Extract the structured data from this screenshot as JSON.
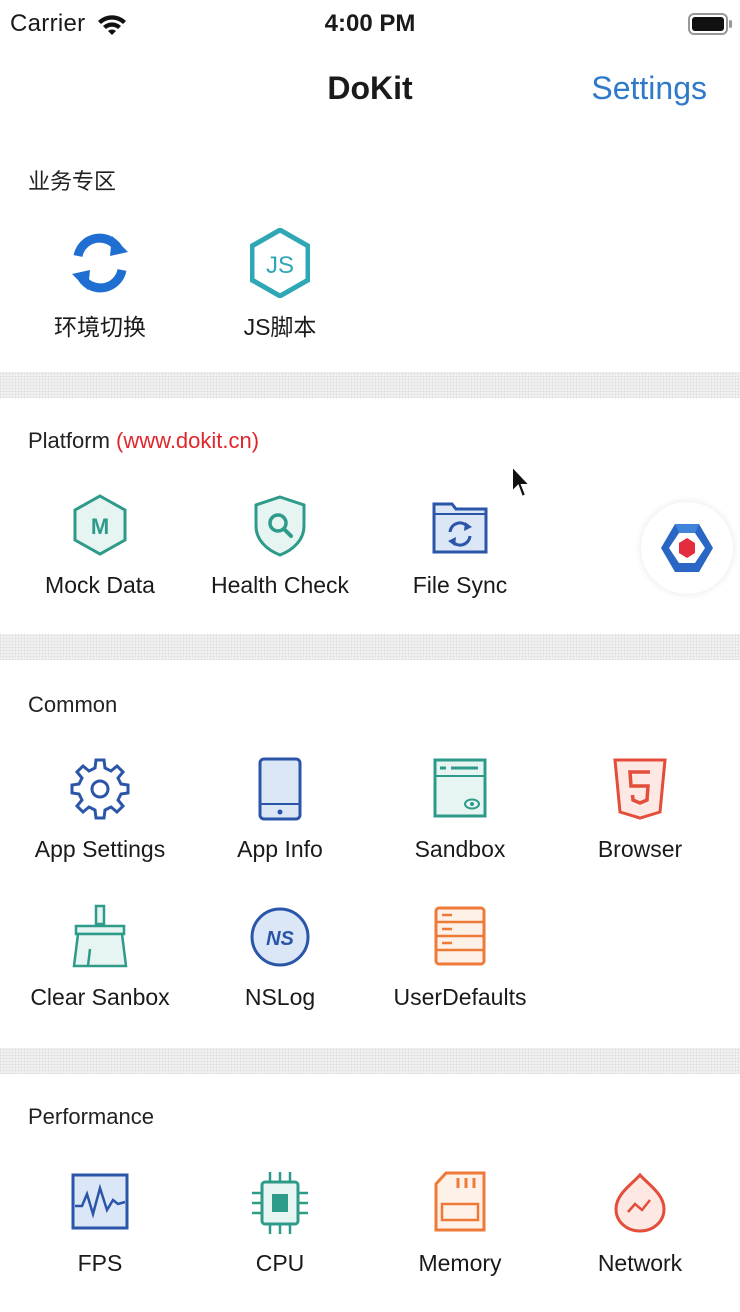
{
  "status_bar": {
    "carrier": "Carrier",
    "time": "4:00 PM"
  },
  "nav": {
    "title": "DoKit",
    "settings_label": "Settings"
  },
  "sections": {
    "business": {
      "title": "业务专区",
      "items": [
        {
          "label": "环境切换",
          "icon": "refresh-icon"
        },
        {
          "label": "JS脚本",
          "icon": "js-icon"
        }
      ]
    },
    "platform": {
      "title": "Platform",
      "url": "(www.dokit.cn)",
      "items": [
        {
          "label": "Mock Data",
          "icon": "mock-data-icon"
        },
        {
          "label": "Health Check",
          "icon": "health-check-icon"
        },
        {
          "label": "File Sync",
          "icon": "file-sync-icon"
        }
      ]
    },
    "common": {
      "title": "Common",
      "items": [
        {
          "label": "App Settings",
          "icon": "gear-icon"
        },
        {
          "label": "App Info",
          "icon": "phone-icon"
        },
        {
          "label": "Sandbox",
          "icon": "sandbox-icon"
        },
        {
          "label": "Browser",
          "icon": "html5-icon"
        },
        {
          "label": "Clear Sanbox",
          "icon": "broom-icon"
        },
        {
          "label": "NSLog",
          "icon": "nslog-icon"
        },
        {
          "label": "UserDefaults",
          "icon": "user-defaults-icon"
        }
      ]
    },
    "performance": {
      "title": "Performance",
      "items": [
        {
          "label": "FPS",
          "icon": "fps-icon"
        },
        {
          "label": "CPU",
          "icon": "cpu-icon"
        },
        {
          "label": "Memory",
          "icon": "memory-icon"
        },
        {
          "label": "Network",
          "icon": "network-icon"
        }
      ]
    }
  },
  "icon_glyphs": {
    "js": "JS",
    "mock": "M",
    "nslog": "NS"
  },
  "colors": {
    "accent_blue": "#2f79c9",
    "refresh_blue": "#1e6fd1",
    "teal": "#2e9a8a",
    "navy": "#2a55a8",
    "html5_red": "#e44d3a",
    "orange": "#ef7a37",
    "url_red": "#e0262b",
    "float_red": "#e32d3d"
  }
}
